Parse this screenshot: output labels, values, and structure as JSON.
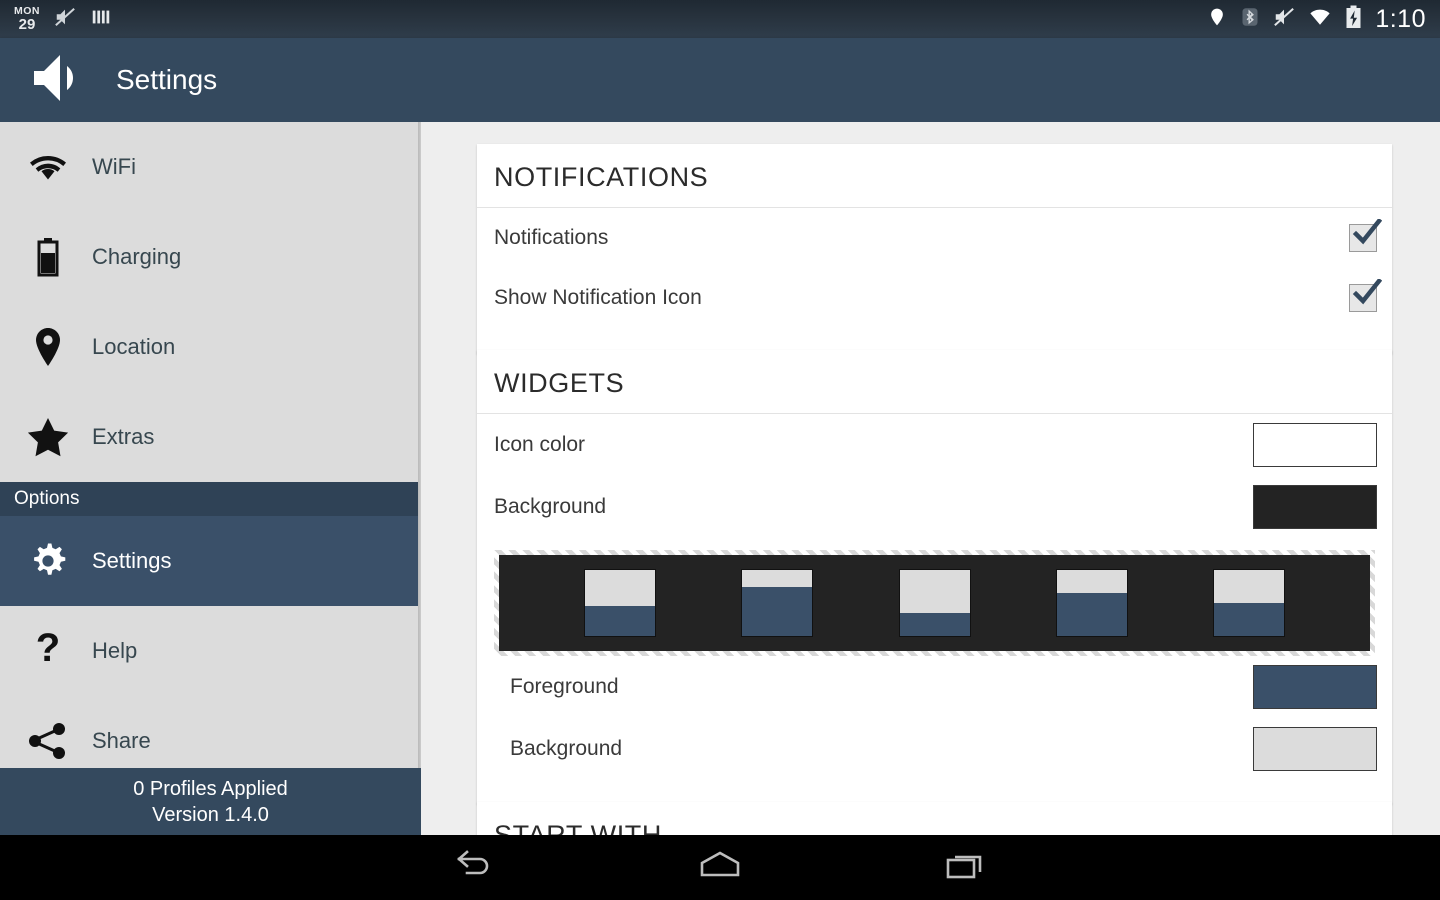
{
  "statusbar": {
    "date_dow": "MON",
    "date_num": "29",
    "clock": "1:10",
    "left_icons": [
      "date-badge",
      "mute-icon",
      "bars-icon"
    ],
    "right_icons": [
      "location-icon",
      "bluetooth-icon",
      "mute-icon",
      "wifi-icon",
      "battery-charging-icon"
    ]
  },
  "appbar": {
    "title": "Settings",
    "icon": "speaker-volume-icon",
    "background": "#34495e"
  },
  "sidebar": {
    "items": [
      {
        "label": "WiFi",
        "icon": "wifi-icon",
        "selected": false
      },
      {
        "label": "Charging",
        "icon": "battery-icon",
        "selected": false
      },
      {
        "label": "Location",
        "icon": "location-pin-icon",
        "selected": false
      },
      {
        "label": "Extras",
        "icon": "star-icon",
        "selected": false
      }
    ],
    "section_header": "Options",
    "option_items": [
      {
        "label": "Settings",
        "icon": "gear-icon",
        "selected": true
      },
      {
        "label": "Help",
        "icon": "question-mark-icon",
        "selected": false
      },
      {
        "label": "Share",
        "icon": "share-icon",
        "selected": false
      }
    ],
    "footer": {
      "profiles": "0 Profiles Applied",
      "version": "Version 1.4.0"
    }
  },
  "content": {
    "cards": [
      {
        "title": "NOTIFICATIONS",
        "rows": [
          {
            "label": "Notifications",
            "control": "checkbox",
            "checked": true
          },
          {
            "label": "Show Notification Icon",
            "control": "checkbox",
            "checked": true
          }
        ]
      },
      {
        "title": "WIDGETS",
        "rows": [
          {
            "label": "Icon color",
            "control": "swatch",
            "color": "#ffffff"
          },
          {
            "label": "Background",
            "control": "swatch",
            "color": "#232323"
          },
          {
            "label": "Foreground",
            "control": "swatch",
            "color": "#3a5069"
          },
          {
            "label": "Background",
            "control": "swatch",
            "color": "#dcdcdc"
          }
        ],
        "preview": {
          "background": "#232323",
          "top_color": "#dcdcdc",
          "fill_color": "#3a5069",
          "bars": [
            45,
            75,
            35,
            65,
            50
          ]
        }
      },
      {
        "title": "START WITH",
        "rows": []
      }
    ]
  },
  "navbar": {
    "buttons": [
      "back-icon",
      "home-icon",
      "recents-icon"
    ]
  },
  "colors": {
    "accent": "#34495e",
    "sidebar_bg": "#dcdcdc",
    "content_bg": "#eeeeee",
    "selected": "#3a5069",
    "section_header": "#2f4256"
  }
}
